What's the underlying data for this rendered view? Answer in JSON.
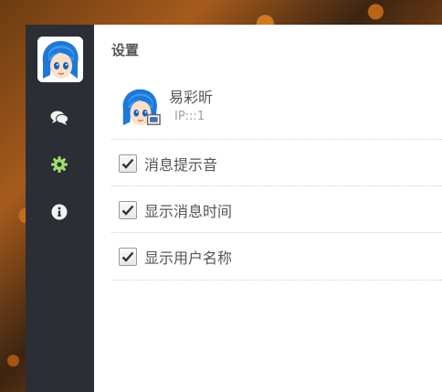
{
  "app": {
    "title": "设置"
  },
  "sidebar": {
    "items": [
      {
        "name": "chat",
        "icon": "chat-bubbles-icon"
      },
      {
        "name": "settings",
        "icon": "gear-icon",
        "active": true
      },
      {
        "name": "info",
        "icon": "info-icon"
      }
    ]
  },
  "profile": {
    "name": "易彩昕",
    "ip": "IP:::1"
  },
  "options": [
    {
      "label": "消息提示音",
      "checked": true
    },
    {
      "label": "显示消息时间",
      "checked": true
    },
    {
      "label": "显示用户名称",
      "checked": true
    }
  ],
  "colors": {
    "sidebar_bg": "#2b2e34",
    "active_icon": "#9fe06b",
    "text": "#555555",
    "muted": "#9aa0a6"
  }
}
